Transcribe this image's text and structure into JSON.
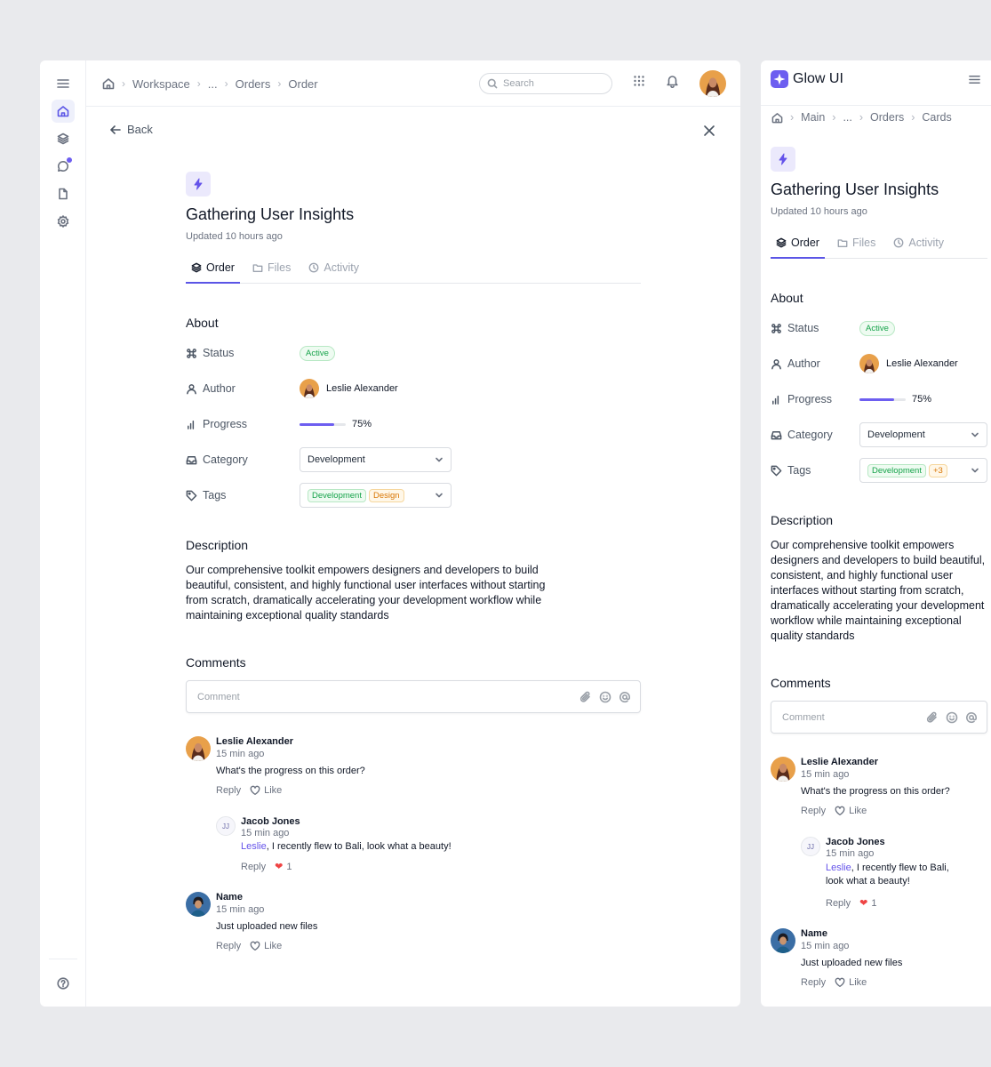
{
  "desktop": {
    "breadcrumb": [
      "Workspace",
      "...",
      "Orders",
      "Order"
    ],
    "search_placeholder": "Search",
    "back_label": "Back",
    "title": "Gathering User Insights",
    "updated": "Updated 10 hours ago",
    "tabs": [
      "Order",
      "Files",
      "Activity"
    ],
    "about_heading": "About",
    "status_label": "Status",
    "status_value": "Active",
    "author_label": "Author",
    "author_value": "Leslie Alexander",
    "progress_label": "Progress",
    "progress_value": "75%",
    "progress_fraction": 0.75,
    "category_label": "Category",
    "category_value": "Development",
    "tags_label": "Tags",
    "tags": [
      "Development",
      "Design"
    ],
    "description_heading": "Description",
    "description": "Our comprehensive toolkit empowers designers and developers to build beautiful, consistent, and highly functional user interfaces without starting from scratch, dramatically accelerating your development workflow while maintaining exceptional quality standards",
    "comments_heading": "Comments",
    "comment_placeholder": "Comment"
  },
  "mobile": {
    "brand": "Glow UI",
    "breadcrumb": [
      "Main",
      "...",
      "Orders",
      "Cards"
    ],
    "tags_extra": "+3"
  },
  "comments": [
    {
      "name": "Leslie Alexander",
      "time": "15 min ago",
      "text": "What's the progress on this order?",
      "reply": "Reply",
      "like": "Like"
    },
    {
      "initials": "JJ",
      "name": "Jacob Jones",
      "time": "15 min ago",
      "mention": "Leslie",
      "text": ", I recently flew to Bali, look what a beauty!",
      "reply": "Reply",
      "likes": "1"
    },
    {
      "name": "Name",
      "time": "15 min ago",
      "text": "Just uploaded new files",
      "reply": "Reply",
      "like": "Like"
    }
  ],
  "colors": {
    "accent": "#5b55e6",
    "active_green": "#16a34a",
    "design_orange": "#d97706",
    "heart": "#ef4444"
  }
}
